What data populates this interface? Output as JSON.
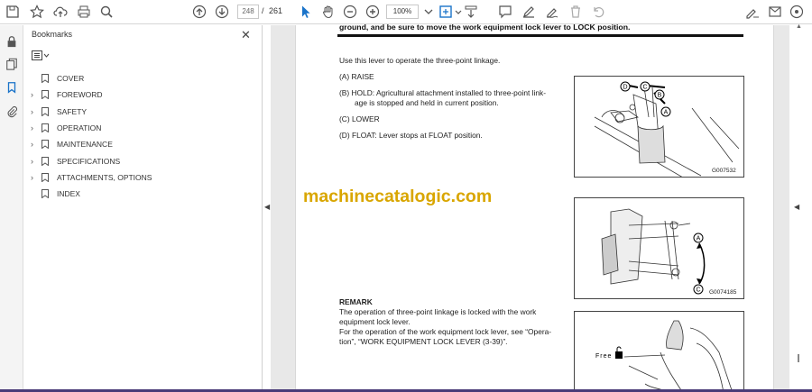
{
  "toolbar": {
    "page_current": "248",
    "page_separator": "/",
    "page_total": "261",
    "zoom": "100%"
  },
  "bookmarks_panel": {
    "title": "Bookmarks",
    "items": [
      {
        "label": "COVER",
        "expandable": false
      },
      {
        "label": "FOREWORD",
        "expandable": true
      },
      {
        "label": "SAFETY",
        "expandable": true
      },
      {
        "label": "OPERATION",
        "expandable": true
      },
      {
        "label": "MAINTENANCE",
        "expandable": true
      },
      {
        "label": "SPECIFICATIONS",
        "expandable": true
      },
      {
        "label": "ATTACHMENTS, OPTIONS",
        "expandable": true
      },
      {
        "label": "INDEX",
        "expandable": false
      }
    ]
  },
  "document": {
    "heading": "ground, and be sure to move the work equipment lock lever to LOCK position.",
    "intro": "Use this lever to operate the three-point linkage.",
    "item_a": "(A) RAISE",
    "item_b_line1": "(B) HOLD: Agricultural attachment installed to three-point link-",
    "item_b_line2": "age is stopped and held in current position.",
    "item_c": "(C) LOWER",
    "item_d": "(D) FLOAT: Lever stops at FLOAT position.",
    "remark_title": "REMARK",
    "remark_line1": "The operation of three-point linkage is locked with the work",
    "remark_line2": "equipment lock lever.",
    "remark_line3": "For the operation of the work equipment lock lever, see “Opera-",
    "remark_line4": "tion”, “WORK EQUIPMENT LOCK LEVER (3-39)”.",
    "watermark": "machinecatalogic.com",
    "figure1_code": "G007532",
    "figure2_code": "G0074185",
    "figure3_label": "Free",
    "callout_a": "A",
    "callout_b": "B",
    "callout_c": "C",
    "callout_d": "D"
  },
  "colors": {
    "watermark": "#d9a600",
    "active_icon": "#1a73c9",
    "bottom_bar": "#4a3b78"
  }
}
